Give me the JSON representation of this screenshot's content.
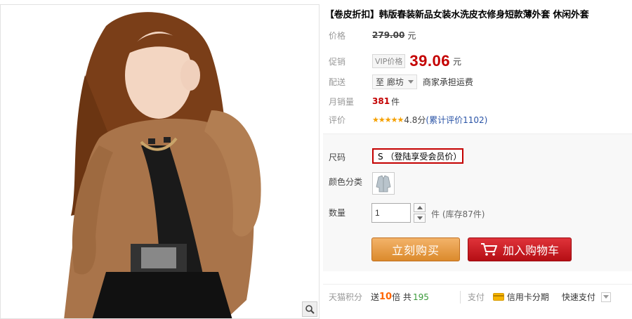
{
  "product": {
    "title": "【卷皮折扣】韩版春装新品女装水洗皮衣修身短款薄外套 休闲外套"
  },
  "price": {
    "label": "价格",
    "original": "279.00",
    "unit": "元"
  },
  "promo": {
    "label": "促销",
    "vip_tag": "VIP价格",
    "price": "39.06",
    "unit": "元"
  },
  "shipping": {
    "label": "配送",
    "region": "至 廊坊",
    "note": "商家承担运费"
  },
  "sales": {
    "label": "月销量",
    "count": "381",
    "unit": "件"
  },
  "rating": {
    "label": "评价",
    "stars": "★★★★★",
    "score": "4.8分",
    "review_link": "(累计评价1102)"
  },
  "options": {
    "size_label": "尺码",
    "size_value": "S （登陆享受会员价）",
    "color_label": "颜色分类",
    "qty_label": "数量",
    "qty_value": "1",
    "stock_text": "件 (库存87件)"
  },
  "actions": {
    "buy_now": "立刻购买",
    "add_cart": "加入购物车"
  },
  "bottom": {
    "points_label": "天猫积分",
    "points_prefix": "送",
    "points_value": "10",
    "points_mid": "倍 共",
    "points_total": "195",
    "pay_label": "支付",
    "credit_label": "信用卡分期",
    "quick_pay": "快速支付"
  },
  "colors": {
    "accent": "#c40000",
    "buy_button": "#db8a2c",
    "cart_button": "#c4161c"
  }
}
